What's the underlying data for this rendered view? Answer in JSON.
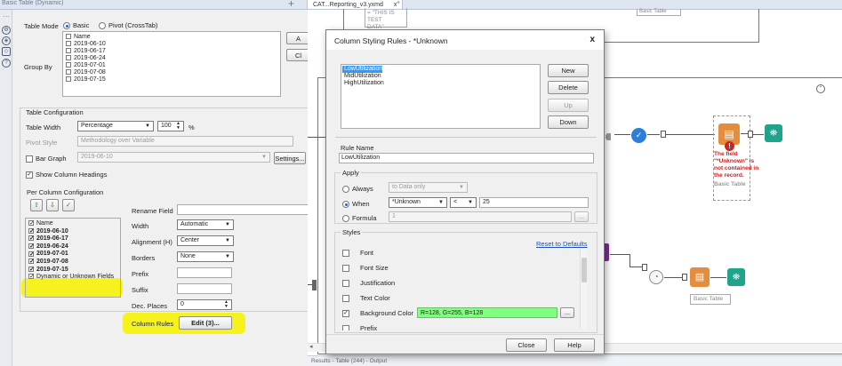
{
  "window": {
    "left_title": "Basic Table (Dynamic)",
    "doc_tab": "CAT...Reporting_v3.yxmd",
    "doc_tab_close": "x",
    "doc_tab_plus": "+",
    "add": "+"
  },
  "config": {
    "table_mode_label": "Table Mode",
    "mode_basic": "Basic",
    "mode_pivot": "Pivot (CrossTab)",
    "group_by_label": "Group By",
    "group_by_items": [
      "Name",
      "2019-06-10",
      "2019-06-17",
      "2019-06-24",
      "2019-07-01",
      "2019-07-08",
      "2019-07-15"
    ],
    "add_btn": "A",
    "clear_btn": "Cl",
    "table_config_title": "Table Configuration",
    "table_width_label": "Table Width",
    "table_width_value": "Percentage",
    "table_width_pct": "100",
    "pct_sign": "%",
    "pivot_style_label": "Pivot Style",
    "pivot_style_value": "Methodology over Variable",
    "bar_graph_label": "Bar Graph",
    "bar_graph_value": "2019-06-10",
    "settings_btn": "Settings...",
    "show_headings_label": "Show Column Headings",
    "per_column_title": "Per Column Configuration",
    "columns": [
      {
        "label": "Name",
        "bold": false
      },
      {
        "label": "2019-06-10",
        "bold": true
      },
      {
        "label": "2019-06-17",
        "bold": true
      },
      {
        "label": "2019-06-24",
        "bold": true
      },
      {
        "label": "2019-07-01",
        "bold": true
      },
      {
        "label": "2019-07-08",
        "bold": true
      },
      {
        "label": "2019-07-15",
        "bold": true
      },
      {
        "label": "Dynamic or Unknown Fields",
        "bold": false
      }
    ],
    "rename_field_label": "Rename Field",
    "width_label": "Width",
    "width_value": "Automatic",
    "alignment_label": "Alignment (H)",
    "alignment_value": "Center",
    "borders_label": "Borders",
    "borders_value": "None",
    "prefix_label": "Prefix",
    "suffix_label": "Suffix",
    "dec_places_label": "Dec. Places",
    "dec_places_value": "0",
    "column_rules_label": "Column Rules",
    "edit_btn": "Edit (3)..."
  },
  "canvas": {
    "test_text_line1": "= \"THIS IS TEST",
    "test_text_line2": "DATA\"",
    "top_right_label": "Basic Table",
    "error_lines": [
      "The field",
      "\"*Unknown\" is",
      "not contained in",
      "the record."
    ],
    "error_tool_label": "Basic Table",
    "lower_tool_label": "Basic Table",
    "status": "Results - Table (244) - Output"
  },
  "dialog": {
    "title": "Column Styling Rules - *Unknown",
    "close": "x",
    "rules": [
      "LowUtilization",
      "MidUtilization",
      "HighUtilization"
    ],
    "selected_rule": 0,
    "new_btn": "New",
    "delete_btn": "Delete",
    "up_btn": "Up",
    "down_btn": "Down",
    "rule_name_label": "Rule Name",
    "rule_name_value": "LowUtilization",
    "apply_label": "Apply",
    "always_label": "Always",
    "always_value": "to Data only",
    "when_label": "When",
    "when_field": "*Unknown",
    "when_op": "<",
    "when_value": "25",
    "formula_label": "Formula",
    "formula_value": "1",
    "formula_btn": "...",
    "styles_label": "Styles",
    "reset_link": "Reset to Defaults",
    "styles": [
      {
        "label": "Font",
        "checked": false
      },
      {
        "label": "Font Size",
        "checked": false
      },
      {
        "label": "Justification",
        "checked": false
      },
      {
        "label": "Text Color",
        "checked": false
      },
      {
        "label": "Background Color",
        "checked": true
      },
      {
        "label": "Prefix",
        "checked": false
      }
    ],
    "bg_color_value": "R=128, G=255, B=128",
    "bg_color_btn": "...",
    "close_btn": "Close",
    "help_btn": "Help",
    "colors": {
      "selection": "#3399ff",
      "background_color": "#80ff80"
    }
  }
}
